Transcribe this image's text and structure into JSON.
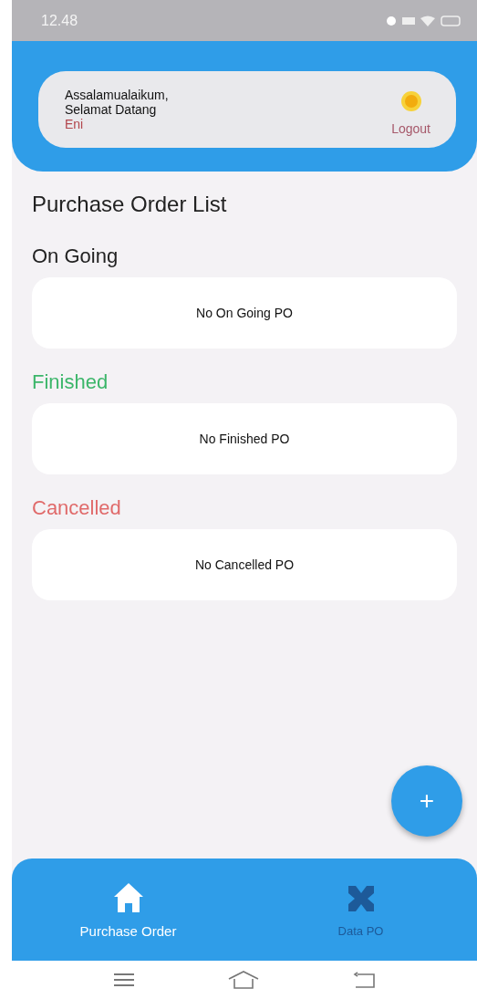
{
  "status_bar": {
    "time": "12.48"
  },
  "header": {
    "greeting": "Assalamualaikum,",
    "welcome": "Selamat Datang",
    "user": "Eni",
    "logout": "Logout"
  },
  "title": "Purchase Order List",
  "sections": [
    {
      "heading": "On Going",
      "color": "#222222",
      "empty": "No On Going PO"
    },
    {
      "heading": "Finished",
      "color": "#3cb66a",
      "empty": "No Finished PO"
    },
    {
      "heading": "Cancelled",
      "color": "#e06a6a",
      "empty": "No Cancelled PO"
    }
  ],
  "fab": {
    "label": "+"
  },
  "bottom_nav": [
    {
      "label": "Purchase Order",
      "kind": "home",
      "selected": true
    },
    {
      "label": "Data PO",
      "kind": "data",
      "selected": false
    }
  ]
}
